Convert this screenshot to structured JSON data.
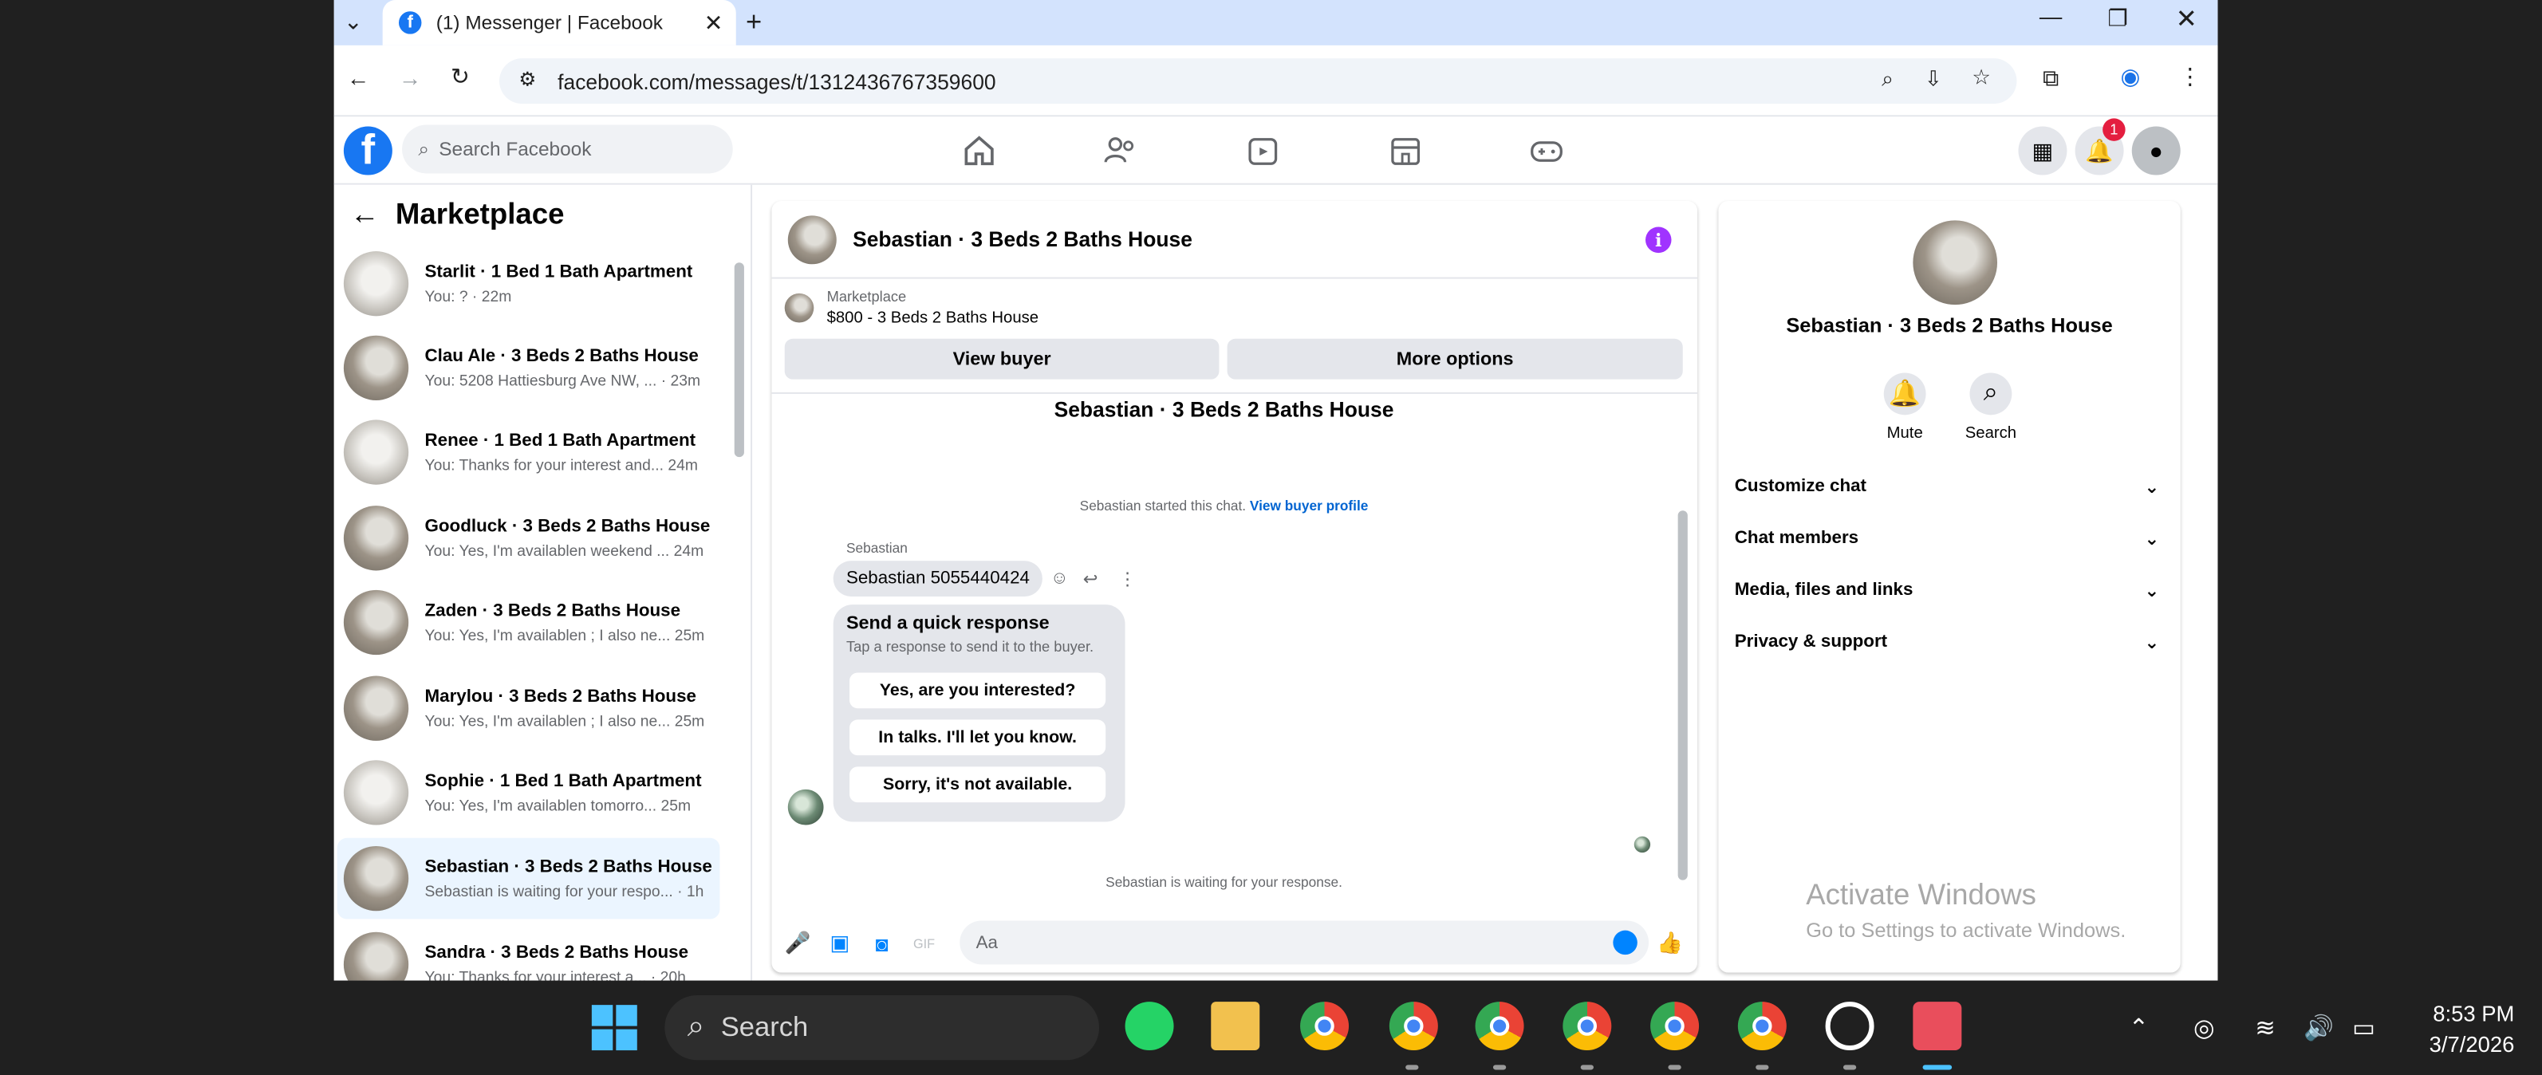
{
  "browser": {
    "tab_title": "(1) Messenger | Facebook",
    "url": "facebook.com/messages/t/1312436767359600"
  },
  "fb": {
    "search_placeholder": "Search Facebook",
    "notification_count": "1"
  },
  "left_panel": {
    "title": "Marketplace",
    "conversations": [
      {
        "name": "Starlit · 1 Bed 1 Bath Apartment",
        "preview": "You: ? · 22m"
      },
      {
        "name": "Clau Ale · 3 Beds 2 Baths House",
        "preview": "You: 5208 Hattiesburg Ave NW, ... · 23m"
      },
      {
        "name": "Renee · 1 Bed 1 Bath Apartment",
        "preview": "You: Thanks for your interest and... 24m"
      },
      {
        "name": "Goodluck · 3 Beds 2 Baths House",
        "preview": "You: Yes, I'm availablen weekend ... 24m"
      },
      {
        "name": "Zaden · 3 Beds 2 Baths House",
        "preview": "You: Yes, I'm availablen ; I also ne... 25m"
      },
      {
        "name": "Marylou · 3 Beds 2 Baths House",
        "preview": "You: Yes, I'm availablen ; I also ne... 25m"
      },
      {
        "name": "Sophie · 1 Bed 1 Bath Apartment",
        "preview": "You: Yes, I'm availablen tomorro... 25m"
      },
      {
        "name": "Sebastian · 3 Beds 2 Baths House",
        "preview": "Sebastian is waiting for your respo... · 1h"
      },
      {
        "name": "Sandra · 3 Beds 2 Baths House",
        "preview": "You: Thanks for your interest a... · 20h"
      }
    ]
  },
  "chat": {
    "header_title": "Sebastian · 3 Beds 2 Baths House",
    "marketplace_label": "Marketplace",
    "listing": "$800 - 3 Beds 2 Baths House",
    "view_buyer": "View buyer",
    "more_options": "More options",
    "thread_title": "Sebastian · 3 Beds 2 Baths House",
    "started_text": "Sebastian started this chat.",
    "view_profile": "View buyer profile",
    "sender": "Sebastian",
    "message": "Sebastian 5055440424",
    "quick_title": "Send a quick response",
    "quick_sub": "Tap a response to send it to the buyer.",
    "quick_replies": [
      "Yes, are you interested?",
      "In talks. I'll let you know.",
      "Sorry, it's not available."
    ],
    "waiting": "Sebastian is waiting for your response.",
    "composer_placeholder": "Aa"
  },
  "right_panel": {
    "name": "Sebastian · 3 Beds 2 Baths House",
    "mute": "Mute",
    "search": "Search",
    "sections": [
      "Customize chat",
      "Chat members",
      "Media, files and links",
      "Privacy & support"
    ]
  },
  "watermark": {
    "line1": "Activate Windows",
    "line2": "Go to Settings to activate Windows."
  },
  "taskbar": {
    "search": "Search",
    "time": "8:53 PM",
    "date": "3/7/2026"
  }
}
